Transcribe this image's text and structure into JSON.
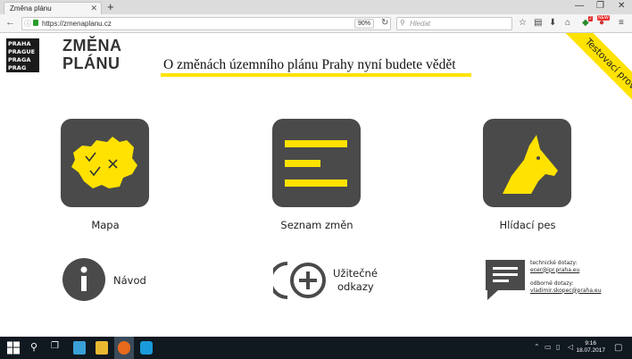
{
  "browser": {
    "tab_title": "Změna plánu",
    "url": "https://zmenaplanu.cz",
    "zoom": "90%",
    "search_placeholder": "Hledat",
    "addon_badge_1": "2",
    "addon_badge_2": "NEW"
  },
  "site": {
    "logo_cells": [
      "PRA",
      "HA",
      "PRA",
      "GUE",
      "PRA",
      "GA",
      "PRA",
      "G"
    ],
    "brand_line1": "ZMĚNA",
    "brand_line2": "PLÁNU",
    "tagline": "O změnách územního plánu Prahy nyní budete vědět",
    "ribbon": "Testovací provoz",
    "accent": "#ffe200",
    "tile_color": "#4a4a4a"
  },
  "tiles": [
    {
      "label": "Mapa",
      "icon": "prague-map-icon"
    },
    {
      "label": "Seznam změn",
      "icon": "list-icon"
    },
    {
      "label": "Hlídací pes",
      "icon": "dog-head-icon"
    }
  ],
  "bottom": {
    "guide_label": "Návod",
    "links_label_line1": "Užitečné",
    "links_label_line2": "odkazy",
    "contact_tech_label": "technické dotazy:",
    "contact_tech_email": "ecer@ipr.praha.eu",
    "contact_expert_label": "odborné dotazy:",
    "contact_expert_email": "vladimir.skopec@praha.eu"
  },
  "taskbar": {
    "time": "9:16",
    "date": "18.07.2017"
  }
}
